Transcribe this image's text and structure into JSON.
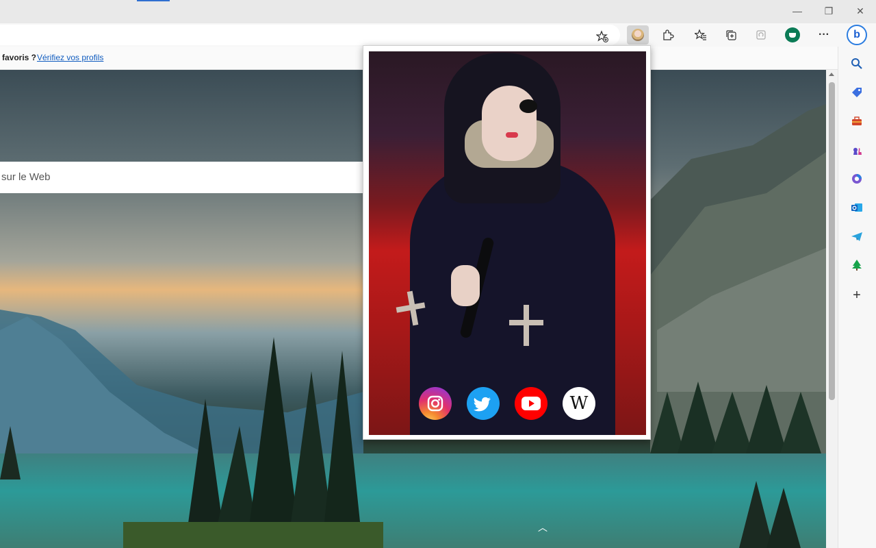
{
  "window": {
    "minimize_glyph": "—",
    "restore_glyph": "❐",
    "close_glyph": "✕"
  },
  "toolbar": {
    "icons": [
      "add-favorite-icon",
      "extension-avatar-icon",
      "extensions-icon",
      "favorites-icon",
      "collections-icon",
      "browser-essentials-icon",
      "coffee-cup-icon",
      "more-icon",
      "bing-icon"
    ],
    "more_glyph": "···",
    "bing_glyph": "b"
  },
  "favorites_bar": {
    "question": "favoris ?",
    "link": "Vérifiez vos profils"
  },
  "page": {
    "search_placeholder": "sur le Web",
    "chevron_glyph": "︿"
  },
  "popup": {
    "social_links": [
      "instagram",
      "twitter",
      "youtube",
      "wikipedia"
    ],
    "wikipedia_glyph": "W"
  },
  "sidebar": {
    "icons": [
      "search-icon",
      "shopping-tag-icon",
      "tools-icon",
      "games-icon",
      "office-icon",
      "outlook-icon",
      "telegram-icon",
      "tree-icon",
      "add-icon"
    ],
    "add_glyph": "+"
  },
  "colors": {
    "accent": "#2f6fd0",
    "link": "#0f5bbf",
    "twitter": "#1da1f2",
    "youtube": "#ff0000"
  }
}
